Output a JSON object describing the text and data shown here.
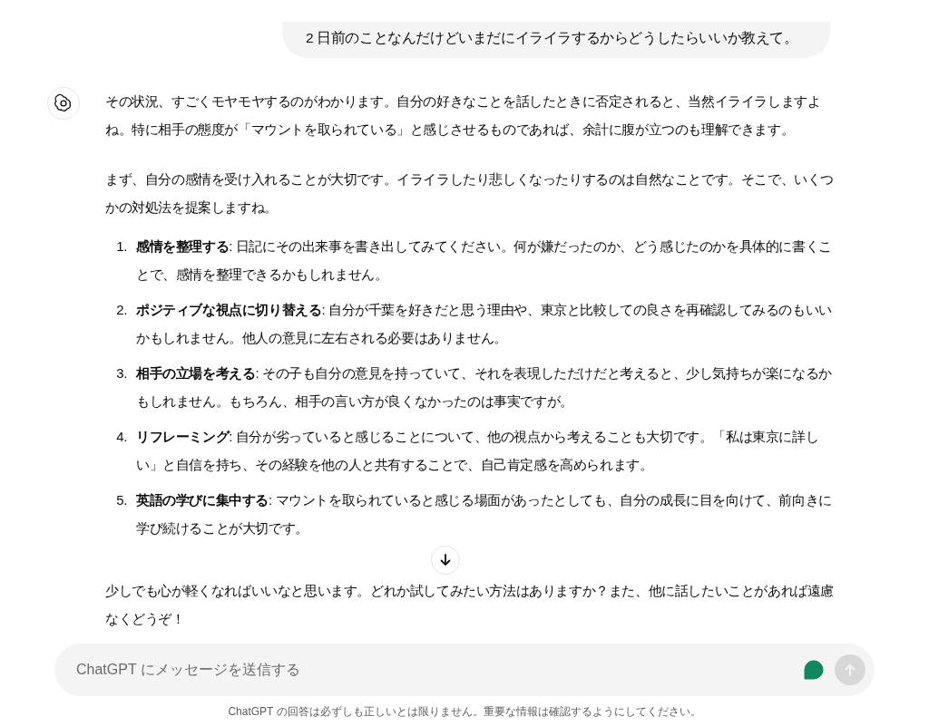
{
  "user_message": "2 日前のことなんだけどいまだにイライラするからどうしたらいいか教えて。",
  "assistant": {
    "paragraphs": [
      "その状況、すごくモヤモヤするのがわかります。自分の好きなことを話したときに否定されると、当然イライラしますよね。特に相手の態度が「マウントを取られている」と感じさせるものであれば、余計に腹が立つのも理解できます。",
      "まず、自分の感情を受け入れることが大切です。イライラしたり悲しくなったりするのは自然なことです。そこで、いくつかの対処法を提案しますね。"
    ],
    "list": [
      {
        "number": "1.",
        "text": "**感情を整理する**: 日記にその出来事を書き出してみてください。何が嫌だったのか、どう感じたのかを具体的に書くことで、感情を整理できるかもしれません。"
      },
      {
        "number": "2.",
        "text": "**ポジティブな視点に切り替える**: 自分が千葉を好きだと思う理由や、東京と比較しての良さを再確認してみるのもいいかもしれません。他人の意見に左右される必要はありません。"
      },
      {
        "number": "3.",
        "text": "**相手の立場を考える**: その子も自分の意見を持っていて、それを表現しただけだと考えると、少し気持ちが楽になるかもしれません。もちろん、相手の言い方が良くなかったのは事実ですが。"
      },
      {
        "number": "4.",
        "text": "**リフレーミング**: 自分が劣っていると感じることについて、他の視点から考えることも大切です。「私は東京に詳しい」と自信を持ち、その経験を他の人と共有することで、自己肯定感を高められます。"
      },
      {
        "number": "5.",
        "text": "**英語の学びに集中する**: マウントを取られていると感じる場面があったとしても、自分の成長に目を向けて、前向きに学び続けることが大切です。"
      }
    ],
    "closing": "少しでも心が軽くなればいいなと思います。どれか試してみたい方法はありますか？また、他に話したいことがあれば遠慮なくどうぞ！"
  },
  "composer": {
    "placeholder": "ChatGPT にメッセージを送信する",
    "send_disabled": true
  },
  "disclaimer": "ChatGPT の回答は必ずしも正しいとは限りません。重要な情報は確認するようにしてください。"
}
